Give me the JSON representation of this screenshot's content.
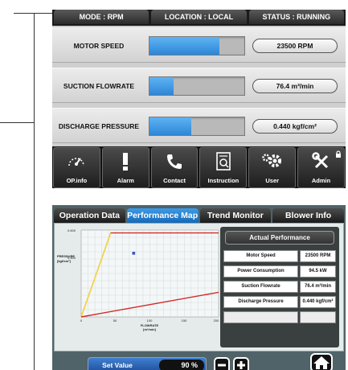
{
  "status_bar": {
    "mode": "MODE : RPM",
    "location": "LOCATION : LOCAL",
    "status": "STATUS : RUNNING"
  },
  "measurements": [
    {
      "label": "MOTOR SPEED",
      "value": "23500 RPM",
      "level_pct": 74
    },
    {
      "label": "SUCTION FLOWRATE",
      "value": "76.4 m³/min",
      "level_pct": 25
    },
    {
      "label": "DISCHARGE PRESSURE",
      "value": "0.440 kgf/cm²",
      "level_pct": 44
    }
  ],
  "toolbar": [
    {
      "label": "OP.info",
      "icon": "gauge-icon"
    },
    {
      "label": "Alarm",
      "icon": "exclamation-icon"
    },
    {
      "label": "Contact",
      "icon": "phone-icon"
    },
    {
      "label": "Instruction",
      "icon": "manual-icon"
    },
    {
      "label": "User",
      "icon": "gears-icon"
    },
    {
      "label": "Admin",
      "icon": "wrench-screwdriver-icon"
    }
  ],
  "tabs": [
    {
      "label": "Operation Data",
      "active": false
    },
    {
      "label": "Performance Map",
      "active": true
    },
    {
      "label": "Trend Monitor",
      "active": false
    },
    {
      "label": "Blower Info",
      "active": false
    }
  ],
  "performance_map": {
    "y_tick_top": "0.600",
    "y_label_1": "PRESSURE",
    "y_label_2": "[kgf/cm²]",
    "y_tick_mid": "0.400",
    "x_ticks": [
      "0",
      "50",
      "100",
      "150",
      "200"
    ],
    "x_label_1": "FLOWRATE",
    "x_label_2": "[m³/min]",
    "colors": {
      "red": "#d22b2b",
      "yellow": "#f2e23a",
      "point": "#3b55c4"
    }
  },
  "chart_data": {
    "type": "line",
    "xlim": [
      0,
      200
    ],
    "ylim": [
      0,
      0.6
    ],
    "grid": true,
    "series": [
      {
        "color": "#d22b2b",
        "points": [
          [
            0,
            0
          ],
          [
            43,
            0.58
          ],
          [
            200,
            0.58
          ]
        ]
      },
      {
        "color": "#f2e23a",
        "points": [
          [
            0,
            0
          ],
          [
            43,
            0.58
          ]
        ]
      },
      {
        "color": "#d22b2b",
        "points": [
          [
            0,
            0
          ],
          [
            200,
            0.17
          ]
        ]
      }
    ],
    "marker": {
      "x": 76.4,
      "y": 0.44,
      "color": "#3b55c4"
    }
  },
  "actual_performance": {
    "title": "Actual Performance",
    "rows": [
      {
        "label": "Motor Speed",
        "value": "23500 RPM"
      },
      {
        "label": "Power Consumption",
        "value": "94.5 kW"
      },
      {
        "label": "Suction Flowrate",
        "value": "76.4 m³/min"
      },
      {
        "label": "Discharge Pressure",
        "value": "0.440 kgf/cm²"
      },
      {
        "label": "",
        "value": ""
      }
    ]
  },
  "set_value": {
    "label": "Set Value",
    "value": "90 %"
  }
}
